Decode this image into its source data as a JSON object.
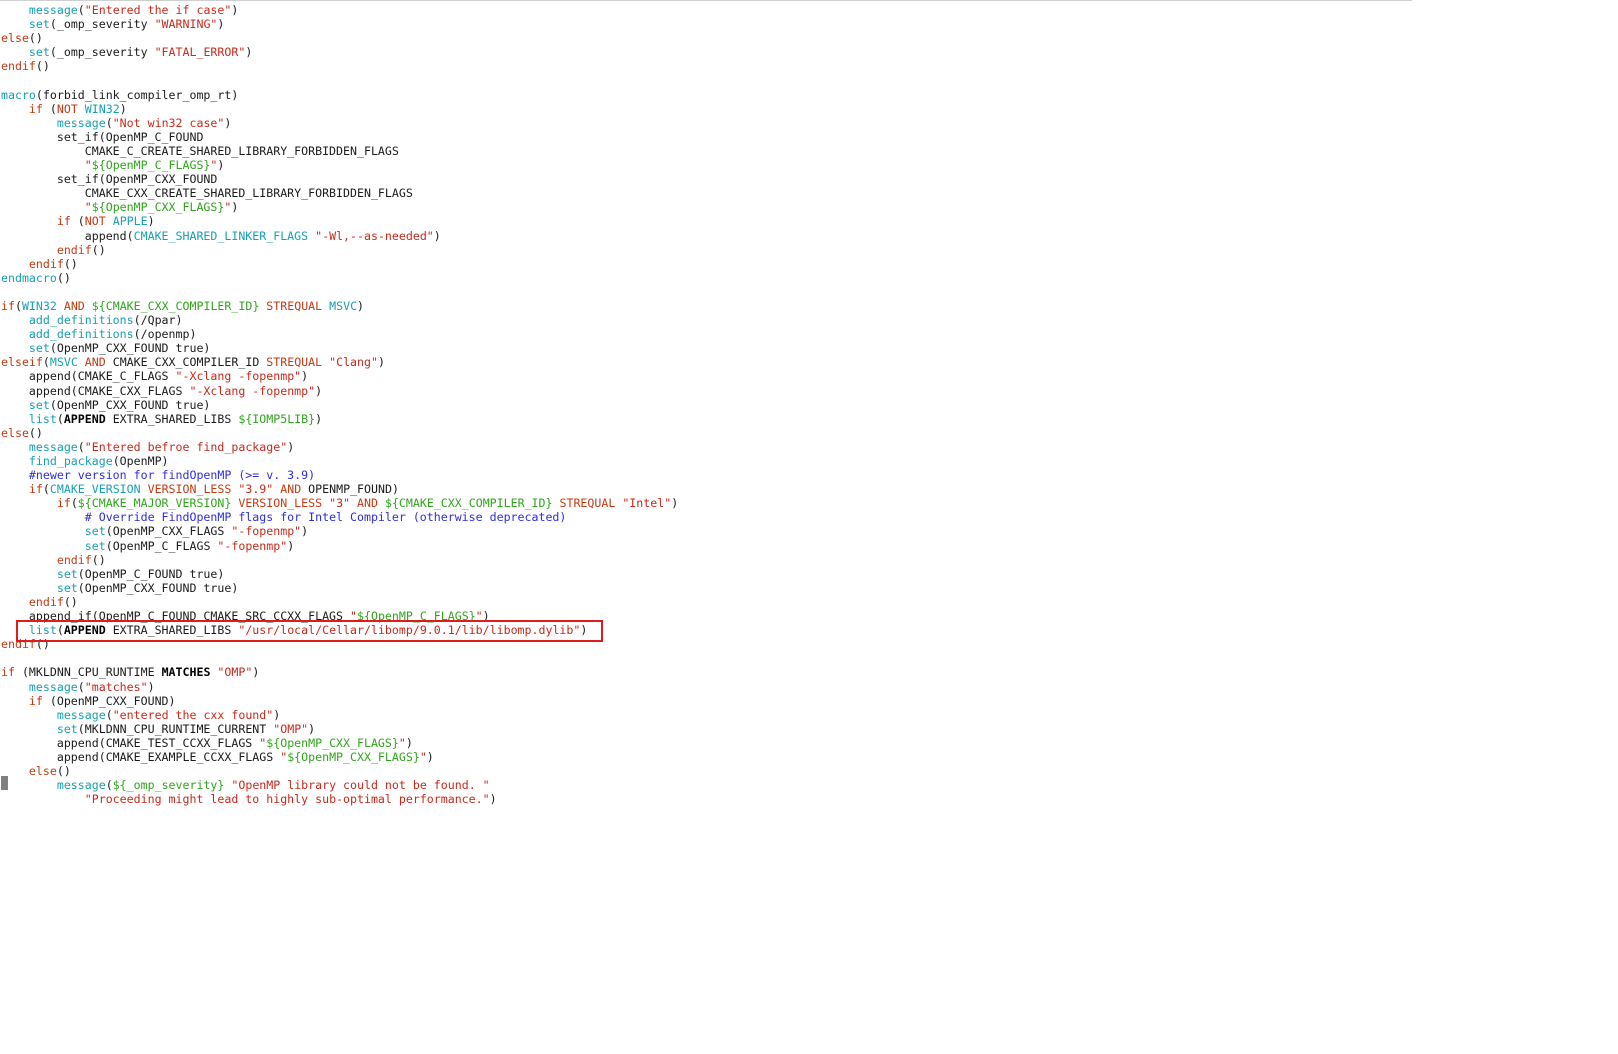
{
  "colors": {
    "default": "#1a1a1a",
    "command": "#16a0b3",
    "keyword": "#c53a11",
    "string": "#c8291b",
    "variable": "#2fa51c",
    "comment": "#2e2ce0",
    "bold": "#000000",
    "highlight": "#e01b1b"
  },
  "code_lines": [
    [
      {
        "t": "    "
      },
      {
        "t": "message",
        "c": "command"
      },
      {
        "t": "("
      },
      {
        "t": "\"Entered the if case\"",
        "c": "string"
      },
      {
        "t": ")"
      }
    ],
    [
      {
        "t": "    "
      },
      {
        "t": "set",
        "c": "command"
      },
      {
        "t": "(_omp_severity "
      },
      {
        "t": "\"WARNING\"",
        "c": "string"
      },
      {
        "t": ")"
      }
    ],
    [
      {
        "t": "else",
        "c": "keyword"
      },
      {
        "t": "()"
      }
    ],
    [
      {
        "t": "    "
      },
      {
        "t": "set",
        "c": "command"
      },
      {
        "t": "(_omp_severity "
      },
      {
        "t": "\"FATAL_ERROR\"",
        "c": "string"
      },
      {
        "t": ")"
      }
    ],
    [
      {
        "t": "endif",
        "c": "keyword"
      },
      {
        "t": "()"
      }
    ],
    [],
    [
      {
        "t": "macro",
        "c": "command"
      },
      {
        "t": "(forbid_link_compiler_omp_rt)"
      }
    ],
    [
      {
        "t": "    "
      },
      {
        "t": "if",
        "c": "keyword"
      },
      {
        "t": " ("
      },
      {
        "t": "NOT",
        "c": "keyword"
      },
      {
        "t": " "
      },
      {
        "t": "WIN32",
        "c": "command"
      },
      {
        "t": ")"
      }
    ],
    [
      {
        "t": "        "
      },
      {
        "t": "message",
        "c": "command"
      },
      {
        "t": "("
      },
      {
        "t": "\"Not win32 case\"",
        "c": "string"
      },
      {
        "t": ")"
      }
    ],
    [
      {
        "t": "        set_if(OpenMP_C_FOUND"
      }
    ],
    [
      {
        "t": "            CMAKE_C_CREATE_SHARED_LIBRARY_FORBIDDEN_FLAGS"
      }
    ],
    [
      {
        "t": "            "
      },
      {
        "t": "\"",
        "c": "string"
      },
      {
        "t": "${OpenMP_C_FLAGS}",
        "c": "variable"
      },
      {
        "t": "\"",
        "c": "string"
      },
      {
        "t": ")"
      }
    ],
    [
      {
        "t": "        set_if(OpenMP_CXX_FOUND"
      }
    ],
    [
      {
        "t": "            CMAKE_CXX_CREATE_SHARED_LIBRARY_FORBIDDEN_FLAGS"
      }
    ],
    [
      {
        "t": "            "
      },
      {
        "t": "\"",
        "c": "string"
      },
      {
        "t": "${OpenMP_CXX_FLAGS}",
        "c": "variable"
      },
      {
        "t": "\"",
        "c": "string"
      },
      {
        "t": ")"
      }
    ],
    [
      {
        "t": "        "
      },
      {
        "t": "if",
        "c": "keyword"
      },
      {
        "t": " ("
      },
      {
        "t": "NOT",
        "c": "keyword"
      },
      {
        "t": " "
      },
      {
        "t": "APPLE",
        "c": "command"
      },
      {
        "t": ")"
      }
    ],
    [
      {
        "t": "            append("
      },
      {
        "t": "CMAKE_SHARED_LINKER_FLAGS",
        "c": "command"
      },
      {
        "t": " "
      },
      {
        "t": "\"-Wl,--as-needed\"",
        "c": "string"
      },
      {
        "t": ")"
      }
    ],
    [
      {
        "t": "        "
      },
      {
        "t": "endif",
        "c": "keyword"
      },
      {
        "t": "()"
      }
    ],
    [
      {
        "t": "    "
      },
      {
        "t": "endif",
        "c": "keyword"
      },
      {
        "t": "()"
      }
    ],
    [
      {
        "t": "endmacro",
        "c": "command"
      },
      {
        "t": "()"
      }
    ],
    [],
    [
      {
        "t": "if",
        "c": "keyword"
      },
      {
        "t": "("
      },
      {
        "t": "WIN32",
        "c": "command"
      },
      {
        "t": " "
      },
      {
        "t": "AND",
        "c": "keyword"
      },
      {
        "t": " "
      },
      {
        "t": "${CMAKE_CXX_COMPILER_ID}",
        "c": "variable"
      },
      {
        "t": " "
      },
      {
        "t": "STREQUAL",
        "c": "keyword"
      },
      {
        "t": " "
      },
      {
        "t": "MSVC",
        "c": "command"
      },
      {
        "t": ")"
      }
    ],
    [
      {
        "t": "    "
      },
      {
        "t": "add_definitions",
        "c": "command"
      },
      {
        "t": "(/Qpar)"
      }
    ],
    [
      {
        "t": "    "
      },
      {
        "t": "add_definitions",
        "c": "command"
      },
      {
        "t": "(/openmp)"
      }
    ],
    [
      {
        "t": "    "
      },
      {
        "t": "set",
        "c": "command"
      },
      {
        "t": "(OpenMP_CXX_FOUND true)"
      }
    ],
    [
      {
        "t": "elseif",
        "c": "keyword"
      },
      {
        "t": "("
      },
      {
        "t": "MSVC",
        "c": "command"
      },
      {
        "t": " "
      },
      {
        "t": "AND",
        "c": "keyword"
      },
      {
        "t": " CMAKE_CXX_COMPILER_ID "
      },
      {
        "t": "STREQUAL",
        "c": "keyword"
      },
      {
        "t": " "
      },
      {
        "t": "\"Clang\"",
        "c": "string"
      },
      {
        "t": ")"
      }
    ],
    [
      {
        "t": "    append(CMAKE_C_FLAGS "
      },
      {
        "t": "\"-Xclang -fopenmp\"",
        "c": "string"
      },
      {
        "t": ")"
      }
    ],
    [
      {
        "t": "    append(CMAKE_CXX_FLAGS "
      },
      {
        "t": "\"-Xclang -fopenmp\"",
        "c": "string"
      },
      {
        "t": ")"
      }
    ],
    [
      {
        "t": "    "
      },
      {
        "t": "set",
        "c": "command"
      },
      {
        "t": "(OpenMP_CXX_FOUND true)"
      }
    ],
    [
      {
        "t": "    "
      },
      {
        "t": "list",
        "c": "command"
      },
      {
        "t": "("
      },
      {
        "t": "APPEND",
        "c": "bold"
      },
      {
        "t": " EXTRA_SHARED_LIBS "
      },
      {
        "t": "${IOMP5LIB}",
        "c": "variable"
      },
      {
        "t": ")"
      }
    ],
    [
      {
        "t": "else",
        "c": "keyword"
      },
      {
        "t": "()"
      }
    ],
    [
      {
        "t": "    "
      },
      {
        "t": "message",
        "c": "command"
      },
      {
        "t": "("
      },
      {
        "t": "\"Entered befroe find_package\"",
        "c": "string"
      },
      {
        "t": ")"
      }
    ],
    [
      {
        "t": "    "
      },
      {
        "t": "find_package",
        "c": "command"
      },
      {
        "t": "(OpenMP)"
      }
    ],
    [
      {
        "t": "    "
      },
      {
        "t": "#newer version for findOpenMP (>= v. 3.9)",
        "c": "comment"
      }
    ],
    [
      {
        "t": "    "
      },
      {
        "t": "if",
        "c": "keyword"
      },
      {
        "t": "("
      },
      {
        "t": "CMAKE_VERSION",
        "c": "command"
      },
      {
        "t": " "
      },
      {
        "t": "VERSION_LESS",
        "c": "keyword"
      },
      {
        "t": " "
      },
      {
        "t": "\"3.9\"",
        "c": "string"
      },
      {
        "t": " "
      },
      {
        "t": "AND",
        "c": "keyword"
      },
      {
        "t": " OPENMP_FOUND)"
      }
    ],
    [
      {
        "t": "        "
      },
      {
        "t": "if",
        "c": "keyword"
      },
      {
        "t": "("
      },
      {
        "t": "${CMAKE_MAJOR_VERSION}",
        "c": "variable"
      },
      {
        "t": " "
      },
      {
        "t": "VERSION_LESS",
        "c": "keyword"
      },
      {
        "t": " "
      },
      {
        "t": "\"3\"",
        "c": "string"
      },
      {
        "t": " "
      },
      {
        "t": "AND",
        "c": "keyword"
      },
      {
        "t": " "
      },
      {
        "t": "${CMAKE_CXX_COMPILER_ID}",
        "c": "variable"
      },
      {
        "t": " "
      },
      {
        "t": "STREQUAL",
        "c": "keyword"
      },
      {
        "t": " "
      },
      {
        "t": "\"Intel\"",
        "c": "string"
      },
      {
        "t": ")"
      }
    ],
    [
      {
        "t": "            "
      },
      {
        "t": "# Override FindOpenMP flags for Intel Compiler (otherwise deprecated)",
        "c": "comment"
      }
    ],
    [
      {
        "t": "            "
      },
      {
        "t": "set",
        "c": "command"
      },
      {
        "t": "(OpenMP_CXX_FLAGS "
      },
      {
        "t": "\"-fopenmp\"",
        "c": "string"
      },
      {
        "t": ")"
      }
    ],
    [
      {
        "t": "            "
      },
      {
        "t": "set",
        "c": "command"
      },
      {
        "t": "(OpenMP_C_FLAGS "
      },
      {
        "t": "\"-fopenmp\"",
        "c": "string"
      },
      {
        "t": ")"
      }
    ],
    [
      {
        "t": "        "
      },
      {
        "t": "endif",
        "c": "keyword"
      },
      {
        "t": "()"
      }
    ],
    [
      {
        "t": "        "
      },
      {
        "t": "set",
        "c": "command"
      },
      {
        "t": "(OpenMP_C_FOUND true)"
      }
    ],
    [
      {
        "t": "        "
      },
      {
        "t": "set",
        "c": "command"
      },
      {
        "t": "(OpenMP_CXX_FOUND true)"
      }
    ],
    [
      {
        "t": "    "
      },
      {
        "t": "endif",
        "c": "keyword"
      },
      {
        "t": "()"
      }
    ],
    [
      {
        "t": "    append_if(OpenMP_C_FOUND CMAKE_SRC_CCXX_FLAGS "
      },
      {
        "t": "\"",
        "c": "string"
      },
      {
        "t": "${OpenMP_C_FLAGS}",
        "c": "variable"
      },
      {
        "t": "\"",
        "c": "string"
      },
      {
        "t": ")"
      }
    ],
    [
      {
        "t": "    "
      },
      {
        "t": "list",
        "c": "command"
      },
      {
        "t": "("
      },
      {
        "t": "APPEND",
        "c": "bold"
      },
      {
        "t": " EXTRA_SHARED_LIBS "
      },
      {
        "t": "\"/usr/local/Cellar/libomp/9.0.1/lib/libomp.dylib\"",
        "c": "string"
      },
      {
        "t": ")"
      }
    ],
    [
      {
        "t": "endif",
        "c": "keyword"
      },
      {
        "t": "()"
      }
    ],
    [],
    [
      {
        "t": "if",
        "c": "keyword"
      },
      {
        "t": " (MKLDNN_CPU_RUNTIME "
      },
      {
        "t": "MATCHES",
        "c": "bold"
      },
      {
        "t": " "
      },
      {
        "t": "\"OMP\"",
        "c": "string"
      },
      {
        "t": ")"
      }
    ],
    [
      {
        "t": "    "
      },
      {
        "t": "message",
        "c": "command"
      },
      {
        "t": "("
      },
      {
        "t": "\"matches\"",
        "c": "string"
      },
      {
        "t": ")"
      }
    ],
    [
      {
        "t": "    "
      },
      {
        "t": "if",
        "c": "keyword"
      },
      {
        "t": " (OpenMP_CXX_FOUND)"
      }
    ],
    [
      {
        "t": "        "
      },
      {
        "t": "message",
        "c": "command"
      },
      {
        "t": "("
      },
      {
        "t": "\"entered the cxx found\"",
        "c": "string"
      },
      {
        "t": ")"
      }
    ],
    [
      {
        "t": "        "
      },
      {
        "t": "set",
        "c": "command"
      },
      {
        "t": "(MKLDNN_CPU_RUNTIME_CURRENT "
      },
      {
        "t": "\"OMP\"",
        "c": "string"
      },
      {
        "t": ")"
      }
    ],
    [
      {
        "t": "        append(CMAKE_TEST_CCXX_FLAGS "
      },
      {
        "t": "\"",
        "c": "string"
      },
      {
        "t": "${OpenMP_CXX_FLAGS}",
        "c": "variable"
      },
      {
        "t": "\"",
        "c": "string"
      },
      {
        "t": ")"
      }
    ],
    [
      {
        "t": "        append(CMAKE_EXAMPLE_CCXX_FLAGS "
      },
      {
        "t": "\"",
        "c": "string"
      },
      {
        "t": "${OpenMP_CXX_FLAGS}",
        "c": "variable"
      },
      {
        "t": "\"",
        "c": "string"
      },
      {
        "t": ")"
      }
    ],
    [
      {
        "t": "    "
      },
      {
        "t": "else",
        "c": "keyword"
      },
      {
        "t": "()"
      }
    ],
    [
      {
        "t": "        "
      },
      {
        "t": "message",
        "c": "command"
      },
      {
        "t": "("
      },
      {
        "t": "${_omp_severity}",
        "c": "variable"
      },
      {
        "t": " "
      },
      {
        "t": "\"OpenMP library could not be found. \"",
        "c": "string"
      }
    ],
    [
      {
        "t": "            "
      },
      {
        "t": "\"Proceeding might lead to highly sub-optimal performance.\"",
        "c": "string"
      },
      {
        "t": ")"
      }
    ]
  ]
}
